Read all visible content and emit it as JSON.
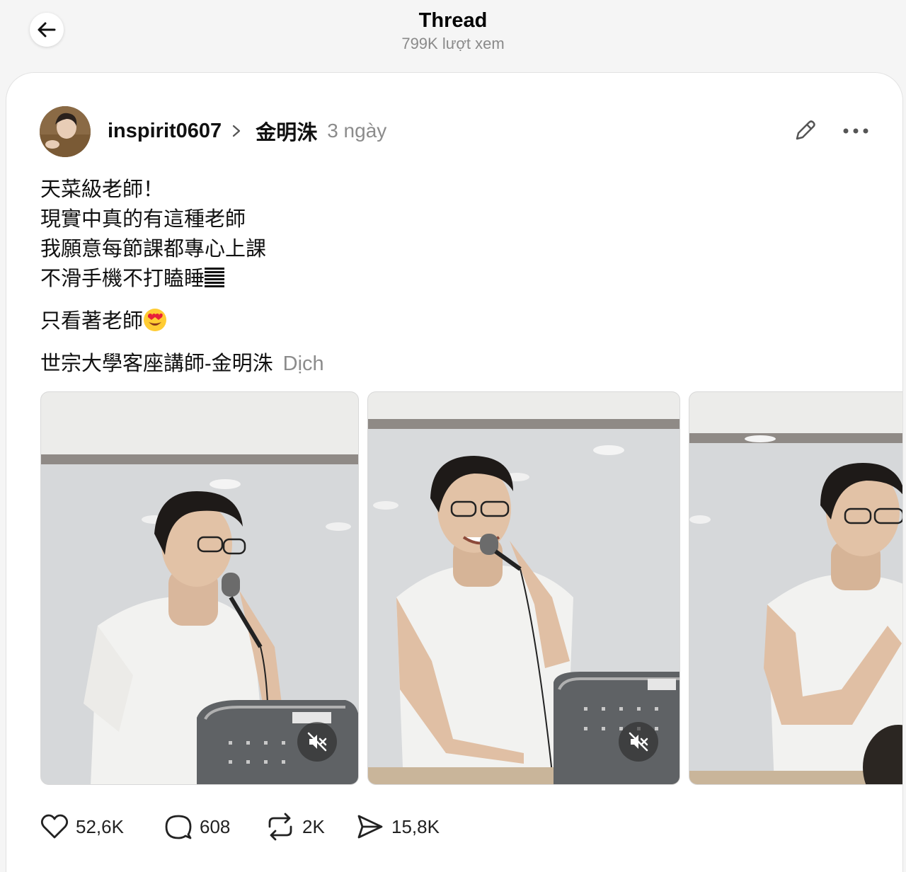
{
  "header": {
    "title": "Thread",
    "subtitle": "799K lượt xem"
  },
  "post": {
    "username": "inspirit0607",
    "tagged": "金明洙",
    "time": "3 ngày",
    "lines": [
      "天菜級老師！",
      "現實中真的有這種老師",
      "我願意每節課都專心上課",
      "不滑手機不打瞌睡"
    ],
    "line5": "只看著老師",
    "line6": "世宗大學客座講師-金明洙",
    "translate": "Dịch"
  },
  "actions": {
    "likes": "52,6K",
    "comments": "608",
    "reposts": "2K",
    "shares": "15,8K"
  },
  "icons": {
    "back": "arrow-left-icon",
    "edit": "pencil-icon",
    "more": "ellipsis-icon",
    "mute": "speaker-muted-icon",
    "like": "heart-icon",
    "comment": "comment-bubble-icon",
    "repost": "repost-icon",
    "share": "send-icon"
  },
  "colors": {
    "background": "#f5f5f5",
    "secondary_text": "#8c8c8c"
  }
}
